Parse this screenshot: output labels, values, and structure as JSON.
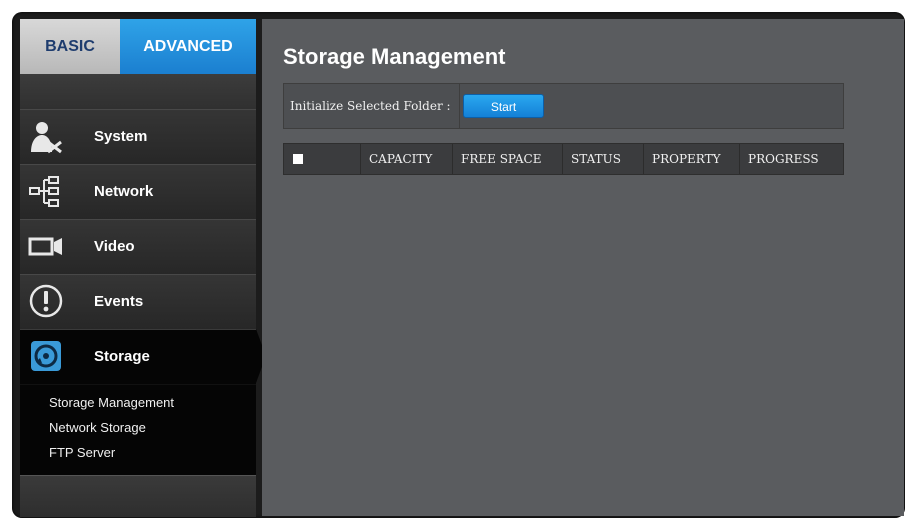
{
  "tabs": {
    "basic": "BASIC",
    "advanced": "ADVANCED"
  },
  "nav": [
    {
      "label": "System",
      "icon": "system-user-tools-icon"
    },
    {
      "label": "Network",
      "icon": "network-tree-icon"
    },
    {
      "label": "Video",
      "icon": "video-camera-icon"
    },
    {
      "label": "Events",
      "icon": "alert-exclamation-icon"
    },
    {
      "label": "Storage",
      "icon": "storage-disk-icon"
    }
  ],
  "submenu": [
    "Storage Management",
    "Network Storage",
    "FTP Server"
  ],
  "page": {
    "title": "Storage Management",
    "init_label": "Initialize Selected Folder :",
    "start_label": "Start"
  },
  "table": {
    "columns": [
      "CAPACITY",
      "FREE SPACE",
      "STATUS",
      "PROPERTY",
      "PROGRESS"
    ],
    "rows": []
  },
  "colors": {
    "accent": "#1e86d6",
    "content_bg": "#5a5c5f",
    "sidebar_bg": "#2a2a2a"
  }
}
